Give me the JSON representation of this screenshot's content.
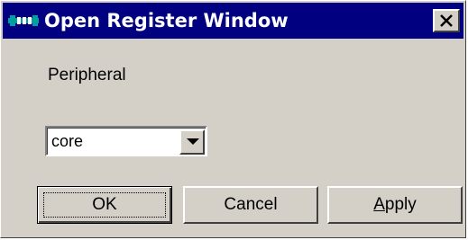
{
  "window": {
    "title": "Open Register Window",
    "icon": "register-window-app-icon",
    "close_glyph": "✕"
  },
  "form": {
    "peripheral_label": "Peripheral",
    "peripheral_value": "core"
  },
  "buttons": {
    "ok_label": "OK",
    "cancel_label": "Cancel",
    "apply_label_prefix": "A",
    "apply_label_rest": "pply"
  },
  "colors": {
    "titlebar": "#000080",
    "face": "#d4d0c8",
    "accent_icon": "#00a0a0"
  }
}
